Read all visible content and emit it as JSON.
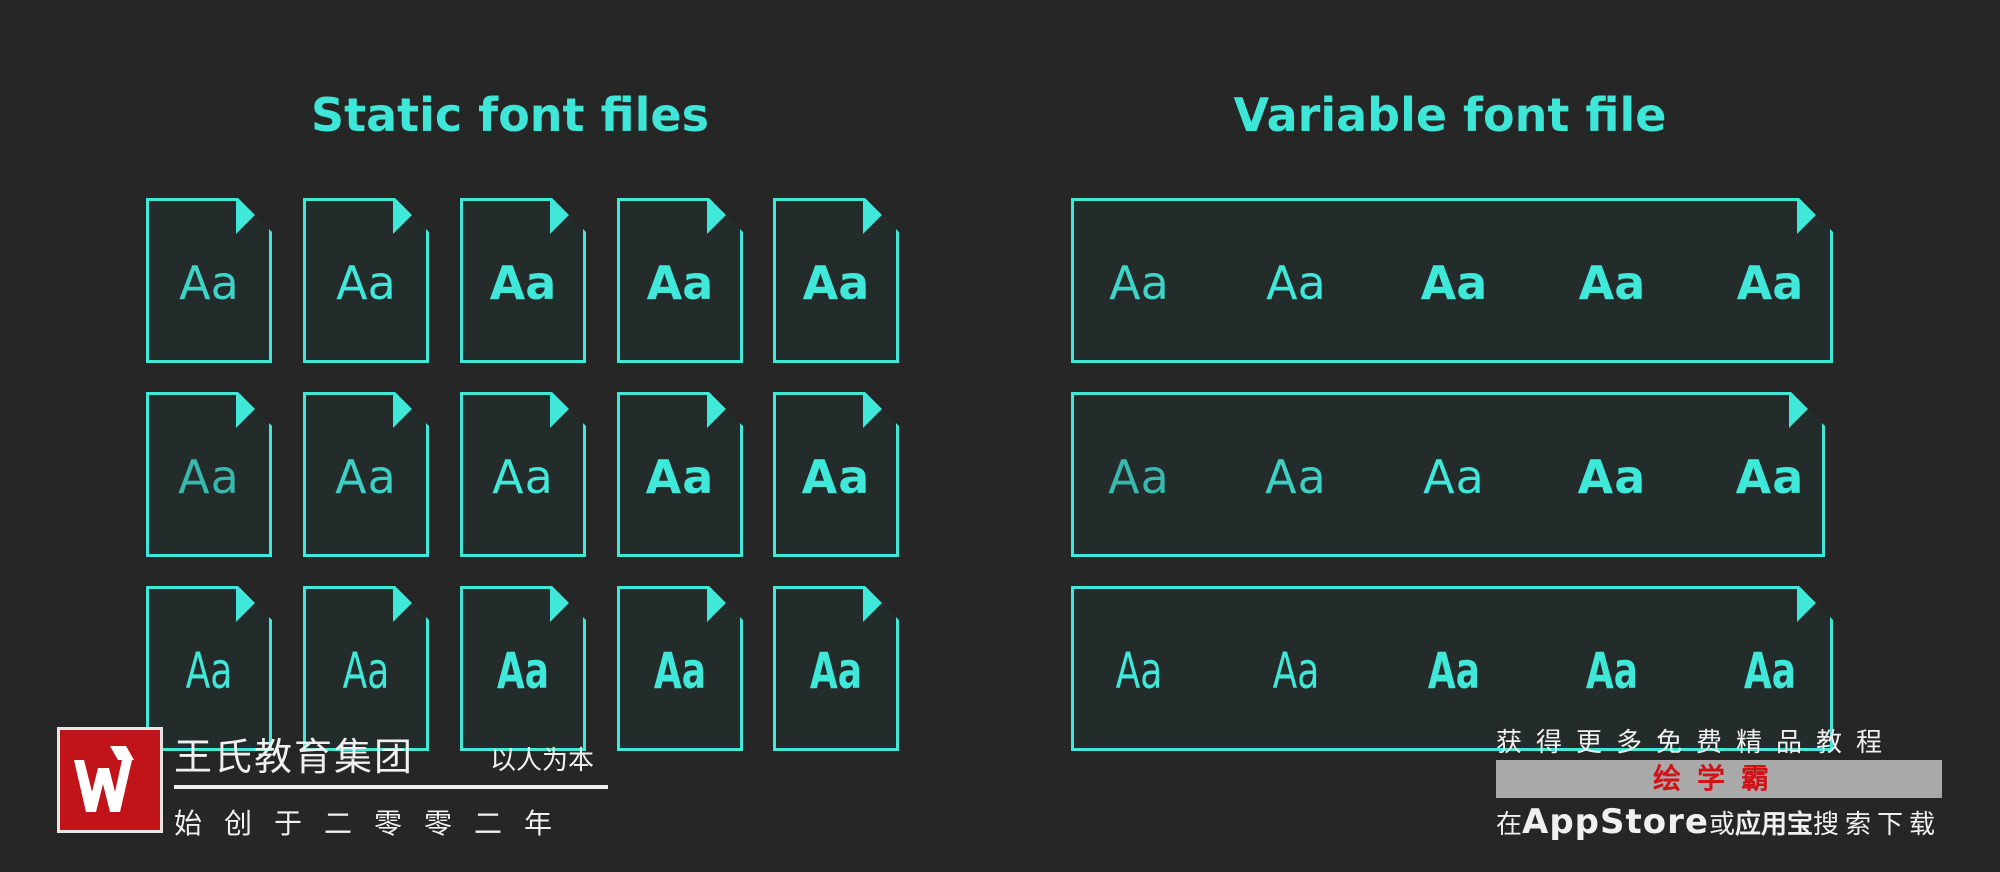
{
  "headings": {
    "static": "Static font files",
    "variable": "Variable font file"
  },
  "sample_glyph": "Aa",
  "colors": {
    "accent": "#40e8da",
    "background": "#262626",
    "file_fill": "#242b2b"
  },
  "static_rows": [
    {
      "family": "sans",
      "weights": [
        200,
        400,
        600,
        700,
        900
      ]
    },
    {
      "family": "thin-sans",
      "weights": [
        100,
        200,
        400,
        600,
        700
      ]
    },
    {
      "family": "condensed",
      "weights": [
        300,
        400,
        700,
        800,
        900
      ]
    }
  ],
  "variable_rows": [
    {
      "family": "sans",
      "weights": [
        200,
        400,
        600,
        700,
        900
      ]
    },
    {
      "family": "thin-sans",
      "weights": [
        100,
        200,
        400,
        600,
        700
      ]
    },
    {
      "family": "condensed",
      "weights": [
        300,
        400,
        700,
        800,
        900
      ]
    }
  ],
  "watermark": {
    "company": "王氏教育集团",
    "slogan": "以人为本",
    "founded": "始创于二零零二年",
    "promo_top": "获得更多免费精品教程",
    "promo_badge": "绘学霸",
    "promo_prefix": "在",
    "promo_store": "AppStore",
    "promo_or": "或",
    "promo_app": "应用宝",
    "promo_suffix": "搜索下载",
    "logo_icon": "wangshi-logo-icon"
  }
}
